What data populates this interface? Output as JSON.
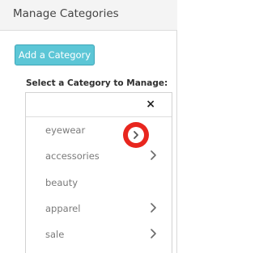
{
  "panel": {
    "title": "Manage Categories",
    "add_button_label": "Add a Category",
    "select_label": "Select a Category to Manage:"
  },
  "dropdown": {
    "close_symbol": "×",
    "items": [
      {
        "label": "eyewear",
        "has_children": true,
        "highlighted": true
      },
      {
        "label": "accessories",
        "has_children": true,
        "highlighted": false
      },
      {
        "label": "beauty",
        "has_children": false,
        "highlighted": false
      },
      {
        "label": "apparel",
        "has_children": true,
        "highlighted": false
      },
      {
        "label": "sale",
        "has_children": true,
        "highlighted": false
      }
    ]
  },
  "colors": {
    "button_bg": "#5cc6d6",
    "highlight": "#e8261e"
  },
  "icons": {
    "chevron": "chevron-right-icon",
    "close": "close-icon"
  }
}
